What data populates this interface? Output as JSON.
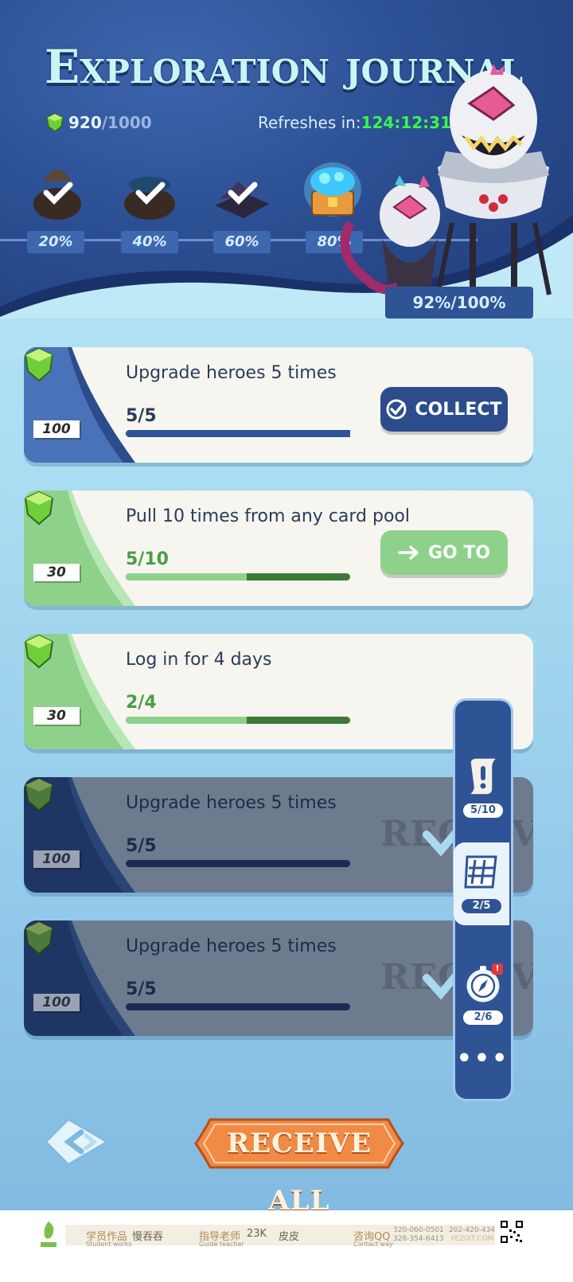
{
  "header": {
    "title": "Exploration journal",
    "currency": {
      "value": "920",
      "max": "/1000",
      "icon": "green-gem-icon"
    },
    "refresh_label": "Refreshes in:",
    "refresh_time": "124:12:31",
    "milestones": [
      {
        "label": "20%",
        "state": "claimed"
      },
      {
        "label": "40%",
        "state": "claimed"
      },
      {
        "label": "60%",
        "state": "claimed"
      },
      {
        "label": "80%",
        "state": "available"
      }
    ],
    "total_progress": "92%/100%"
  },
  "tasks": [
    {
      "reward": "100",
      "title": "Upgrade heroes 5 times",
      "count": "5/5",
      "progress": 1.0,
      "action": "COLLECT",
      "state": "collect"
    },
    {
      "reward": "30",
      "title": "Pull 10 times from any card pool",
      "count": "5/10",
      "progress": 0.5,
      "action": "GO TO",
      "state": "goto"
    },
    {
      "reward": "30",
      "title": "Log in for 4 days",
      "count": "2/4",
      "progress": 0.5,
      "action": "",
      "state": "inprogress"
    },
    {
      "reward": "100",
      "title": "Upgrade heroes 5 times",
      "count": "5/5",
      "progress": 1.0,
      "action": "RECEIVED",
      "state": "received"
    },
    {
      "reward": "100",
      "title": "Upgrade heroes 5 times",
      "count": "5/5",
      "progress": 1.0,
      "action": "RECEIVED",
      "state": "received"
    }
  ],
  "side_panel": {
    "items": [
      {
        "icon": "scroll-alert-icon",
        "count": "5/10"
      },
      {
        "icon": "map-grid-icon",
        "count": "2/5",
        "active": true
      },
      {
        "icon": "compass-icon",
        "count": "2/6",
        "badge": "!"
      }
    ],
    "more": "•••"
  },
  "bottom": {
    "receive_all": "RECEIVE ALL"
  },
  "footer": {
    "student_label": "学员作品",
    "student_label_en": "Student works",
    "student_name": "慢吞吞",
    "teacher_label": "指导老师",
    "teacher_label_en": "Guide teacher",
    "teacher_name_1": "23K",
    "teacher_name_2": "皮皮",
    "contact_label": "咨询QQ",
    "contact_label_en": "Contact way",
    "phone_1": "320-060-0501",
    "phone_2": "328-354-6413",
    "phone_3": "202-420-434",
    "site": "YEZIXT.COM"
  },
  "colors": {
    "accent_blue": "#2f5495",
    "accent_green": "#8ed18a",
    "timer_green": "#39f54f",
    "receive_orange": "#ef8a4a"
  }
}
